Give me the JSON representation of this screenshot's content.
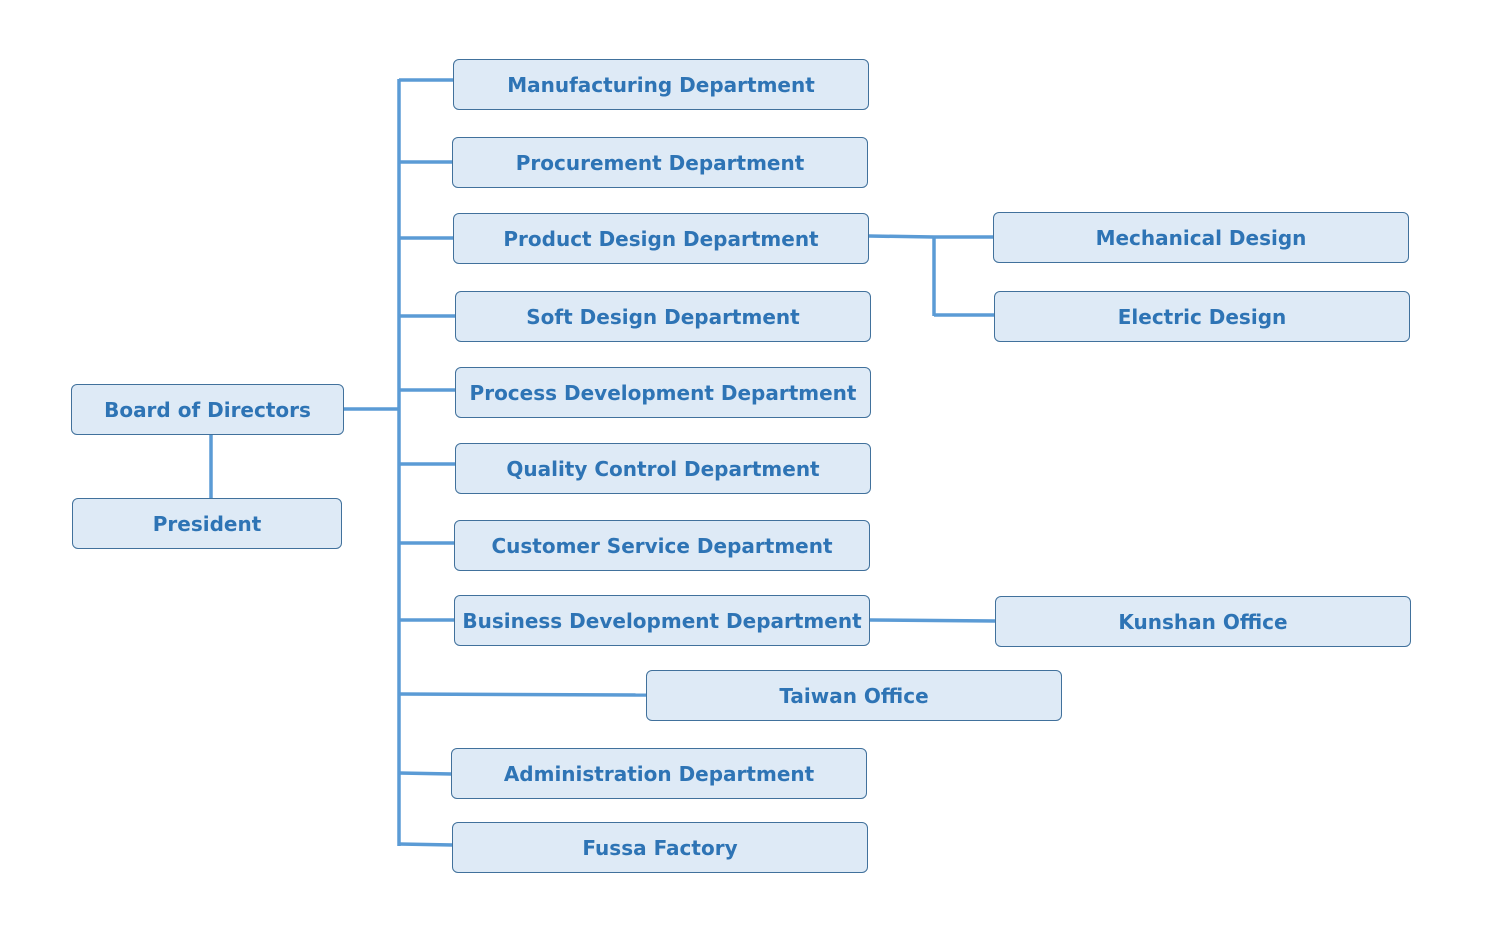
{
  "colors": {
    "box_fill": "#deeaf6",
    "box_border": "#41719c",
    "text": "#2e74b5",
    "connector": "#5b9bd5"
  },
  "nodes": {
    "board": "Board of Directors",
    "president": "President",
    "manufacturing": "Manufacturing Department",
    "procurement": "Procurement Department",
    "product_design": "Product Design Department",
    "soft_design": "Soft Design Department",
    "process_dev": "Process Development Department",
    "quality": "Quality Control Department",
    "customer": "Customer Service Department",
    "business": "Business Development Department",
    "taiwan": "Taiwan Office",
    "admin": "Administration Department",
    "fussa": "Fussa Factory",
    "mechanical": "Mechanical Design",
    "electric": "Electric Design",
    "kunshan": "Kunshan Office"
  }
}
